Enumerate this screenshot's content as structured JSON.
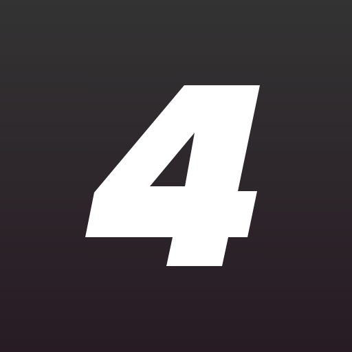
{
  "icon": {
    "glyph_text": "4",
    "glyph_name": "number-four-glyph",
    "colors": {
      "background_top": "#333333",
      "background_bottom": "#281b24",
      "glyph": "#ffffff"
    }
  }
}
